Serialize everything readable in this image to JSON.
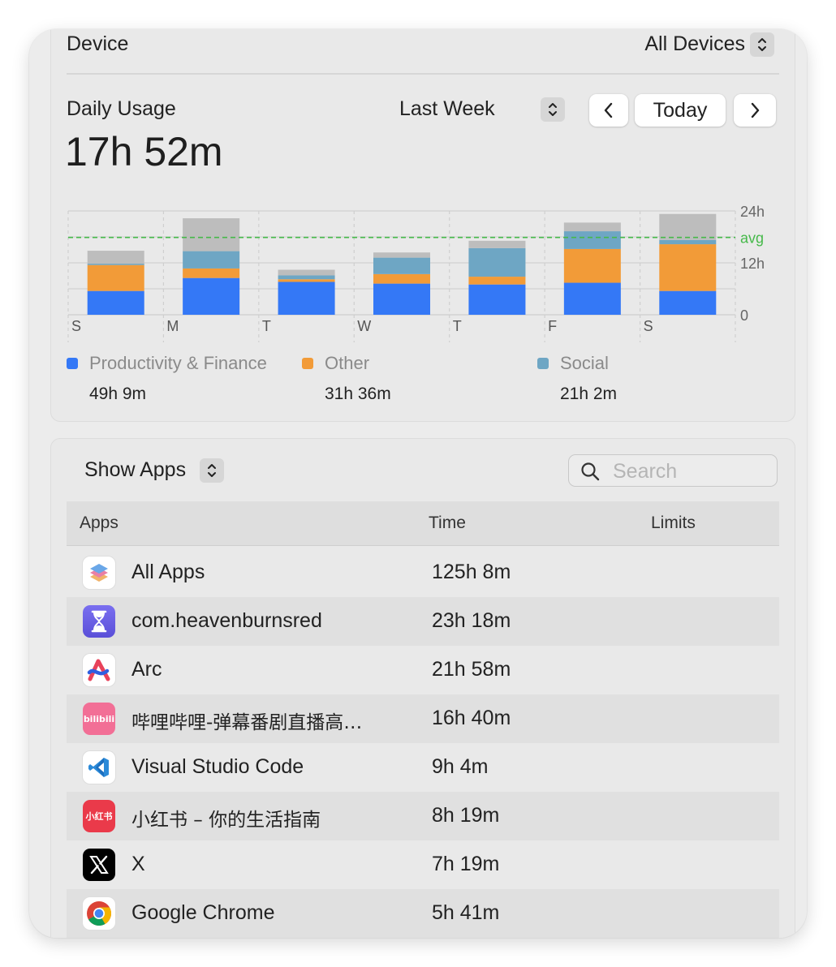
{
  "device": {
    "label": "Device",
    "value": "All Devices"
  },
  "usage": {
    "title": "Daily Usage",
    "total": "17h 52m",
    "range": "Last Week",
    "today_label": "Today"
  },
  "chart_data": {
    "type": "bar",
    "stacked": true,
    "categories": [
      "S",
      "M",
      "T",
      "W",
      "T",
      "F",
      "S"
    ],
    "y_ticks": [
      "24h",
      "12h",
      "0"
    ],
    "avg_label": "avg",
    "avg_value": 17.87,
    "ylim": [
      0,
      24
    ],
    "grid": true,
    "series": [
      {
        "name": "Productivity & Finance",
        "color": "#3478f6",
        "values": [
          5.5,
          8.5,
          7.6,
          7.2,
          7.0,
          7.4,
          5.5
        ]
      },
      {
        "name": "Other",
        "color": "#f29b38",
        "values": [
          6.0,
          2.2,
          0.6,
          2.2,
          1.8,
          7.8,
          10.8
        ]
      },
      {
        "name": "Social",
        "color": "#6ea6c4",
        "values": [
          0.3,
          4.0,
          0.9,
          3.8,
          6.6,
          4.1,
          1.0
        ]
      },
      {
        "color": "#bdbdbd",
        "values": [
          3.0,
          7.6,
          1.3,
          1.2,
          1.7,
          2.0,
          6.0
        ]
      }
    ]
  },
  "legend": [
    {
      "name": "Productivity & Finance",
      "total": "49h 9m",
      "color": "#3478f6"
    },
    {
      "name": "Other",
      "total": "31h 36m",
      "color": "#f29b38"
    },
    {
      "name": "Social",
      "total": "21h 2m",
      "color": "#6ea6c4"
    }
  ],
  "apps_panel": {
    "show_label": "Show Apps",
    "search_placeholder": "Search",
    "columns": {
      "apps": "Apps",
      "time": "Time",
      "limits": "Limits"
    },
    "rows": [
      {
        "name": "All Apps",
        "time": "125h 8m",
        "icon": "layers-icon"
      },
      {
        "name": "com.heavenburnsred",
        "time": "23h 18m",
        "icon": "hourglass-icon"
      },
      {
        "name": "Arc",
        "time": "21h 58m",
        "icon": "arc-icon"
      },
      {
        "name": "哔哩哔哩-弹幕番剧直播高…",
        "time": "16h 40m",
        "icon": "bilibili-icon"
      },
      {
        "name": "Visual Studio Code",
        "time": "9h 4m",
        "icon": "vscode-icon"
      },
      {
        "name": "小红书 – 你的生活指南",
        "time": "8h 19m",
        "icon": "xiaohongshu-icon"
      },
      {
        "name": "X",
        "time": "7h 19m",
        "icon": "x-icon"
      },
      {
        "name": "Google Chrome",
        "time": "5h 41m",
        "icon": "chrome-icon"
      }
    ]
  },
  "icon_text": {
    "bilibili": "bilibili",
    "xiaohongshu": "小红书"
  }
}
